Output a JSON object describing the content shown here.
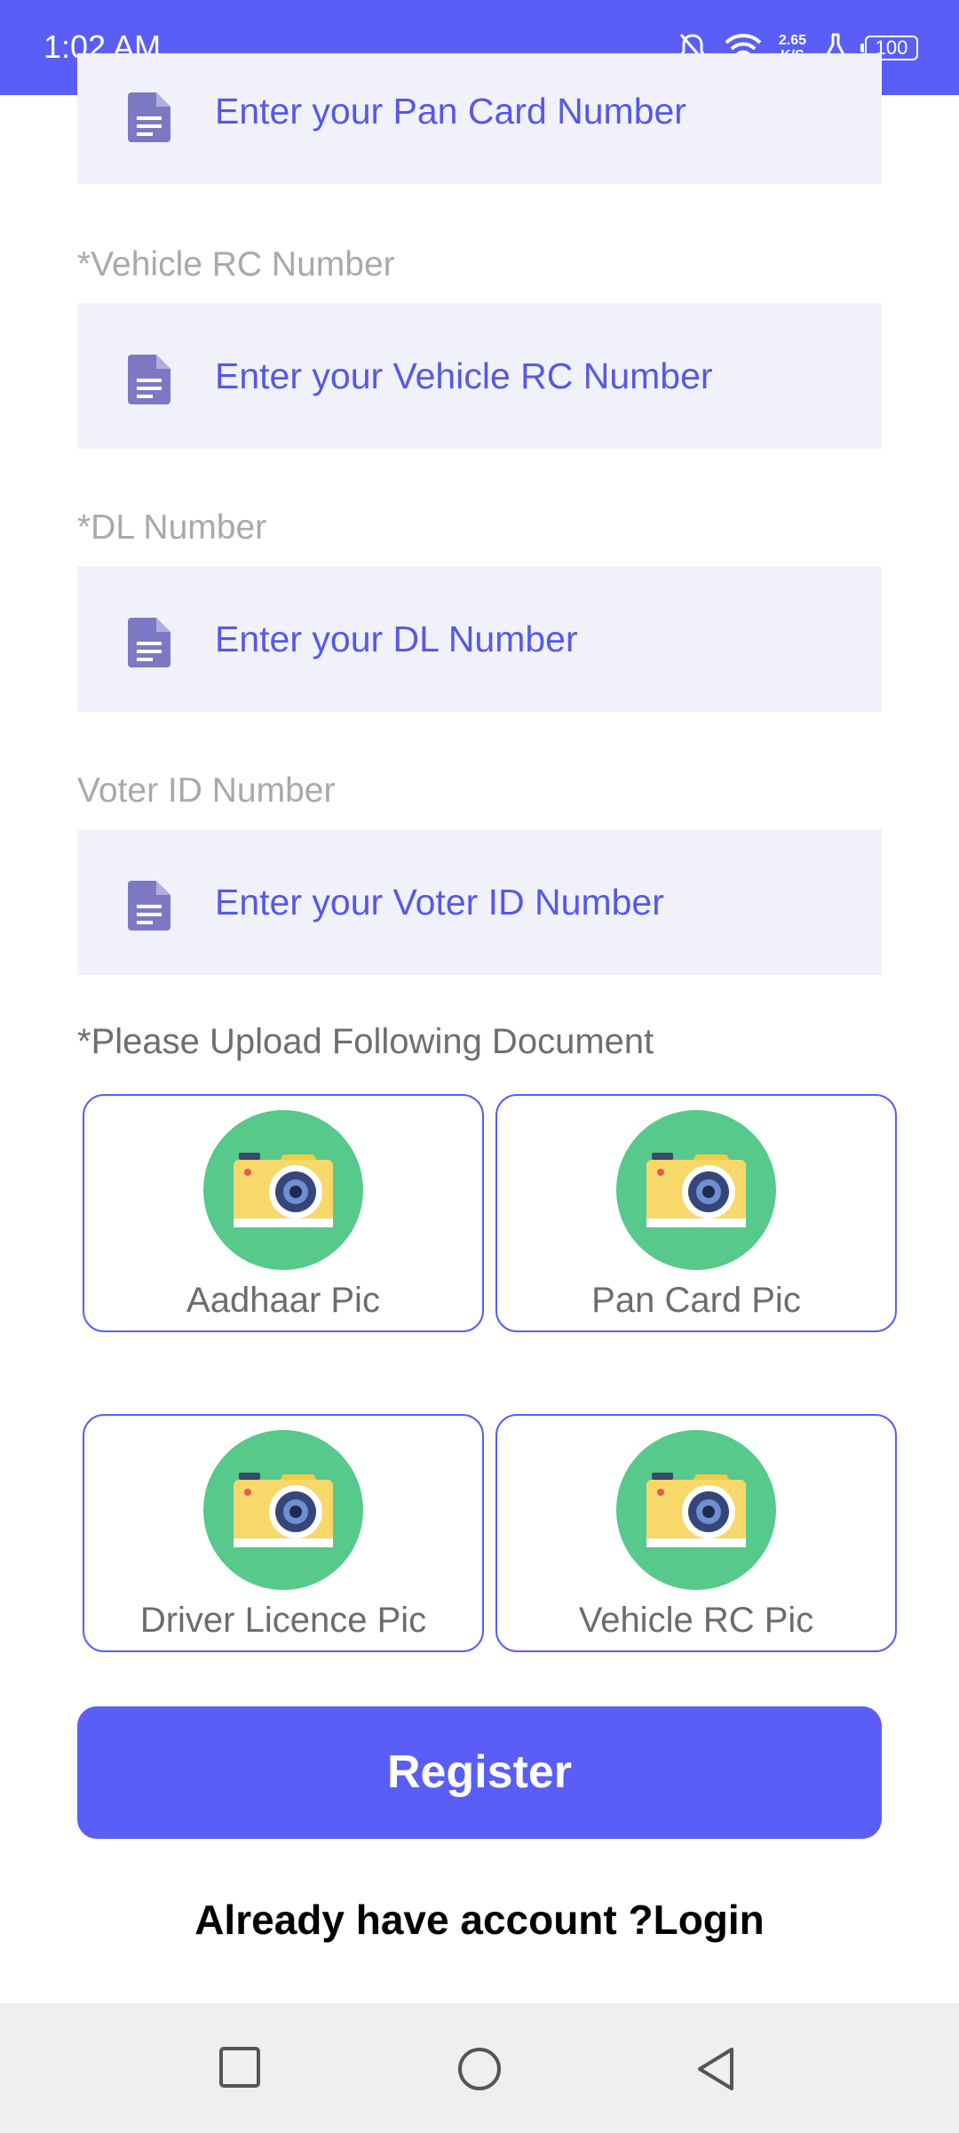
{
  "status_bar": {
    "time": "1:02 AM",
    "speed_value": "2.65",
    "speed_unit": "K/S",
    "battery": "100"
  },
  "form": {
    "pan_placeholder": "Enter your Pan Card Number",
    "vehicle_rc_label": "*Vehicle RC Number",
    "vehicle_rc_placeholder": "Enter your Vehicle RC Number",
    "dl_label": "*DL Number",
    "dl_placeholder": "Enter your DL Number",
    "voter_label": "Voter ID Number",
    "voter_placeholder": "Enter your Voter ID Number"
  },
  "upload": {
    "heading": "*Please Upload Following Document",
    "items": [
      {
        "label": "Aadhaar Pic"
      },
      {
        "label": "Pan Card Pic"
      },
      {
        "label": "Driver Licence Pic"
      },
      {
        "label": "Vehicle RC Pic"
      }
    ]
  },
  "actions": {
    "register_label": "Register",
    "login_text": "Already have account ?Login"
  },
  "colors": {
    "accent": "#5a5ef6",
    "field_bg": "#f1f1fb",
    "camera_circle": "#56c98b"
  }
}
